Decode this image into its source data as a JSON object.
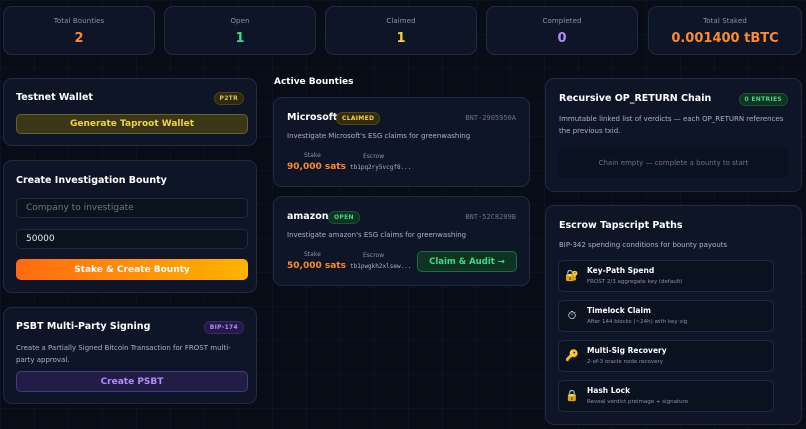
{
  "stats": [
    {
      "label": "Total Bounties",
      "value": "2",
      "color": "#ff8a2b"
    },
    {
      "label": "Open",
      "value": "1",
      "color": "#3ddc84"
    },
    {
      "label": "Claimed",
      "value": "1",
      "color": "#f5d142"
    },
    {
      "label": "Completed",
      "value": "0",
      "color": "#b18cff"
    },
    {
      "label": "Total Staked",
      "value": "0.001400 tBTC",
      "color": "#ff8a2b"
    }
  ],
  "wallet": {
    "title": "Testnet Wallet",
    "badge": "P2TR",
    "button": "Generate Taproot Wallet"
  },
  "create": {
    "title": "Create Investigation Bounty",
    "company_placeholder": "Company to investigate",
    "amount_value": "50000",
    "button": "Stake & Create Bounty"
  },
  "psbt": {
    "title": "PSBT Multi-Party Signing",
    "badge": "BIP-174",
    "description": "Create a Partially Signed Bitcoin Transaction for FROST multi-party approval.",
    "button": "Create PSBT"
  },
  "active": {
    "heading": "Active Bounties",
    "bounties": [
      {
        "company": "Microsoft",
        "status": "CLAIMED",
        "id": "BNT-2905950A",
        "description": "Investigate Microsoft's ESG claims for greenwashing",
        "stake_label": "Stake",
        "stake": "90,000 sats",
        "escrow_label": "Escrow",
        "escrow": "tb1pq2ry5vcgf8..."
      },
      {
        "company": "amazon",
        "status": "OPEN",
        "id": "BNT-52C8209B",
        "description": "Investigate amazon's ESG claims for greenwashing",
        "stake_label": "Stake",
        "stake": "50,000 sats",
        "escrow_label": "Escrow",
        "escrow": "tb1pwgkh2xlsew...",
        "action": "Claim & Audit →"
      }
    ]
  },
  "chain": {
    "title": "Recursive OP_RETURN Chain",
    "badge": "0 ENTRIES",
    "description": "Immutable linked list of verdicts — each OP_RETURN references the previous txid.",
    "empty": "Chain empty — complete a bounty to start"
  },
  "escrow": {
    "title": "Escrow Tapscript Paths",
    "subtitle": "BIP-342 spending conditions for bounty payouts",
    "paths": [
      {
        "icon": "key-lock-icon",
        "glyph": "🔐",
        "title": "Key-Path Spend",
        "desc": "FROST 2/3 aggregate key (default)"
      },
      {
        "icon": "stopwatch-icon",
        "glyph": "⏱",
        "title": "Timelock Claim",
        "desc": "After 144 blocks (~24h) with key sig"
      },
      {
        "icon": "key-icon",
        "glyph": "🔑",
        "title": "Multi-Sig Recovery",
        "desc": "2-of-3 oracle node recovery"
      },
      {
        "icon": "lock-icon",
        "glyph": "🔒",
        "title": "Hash Lock",
        "desc": "Reveal verdict preimage + signature"
      }
    ]
  }
}
